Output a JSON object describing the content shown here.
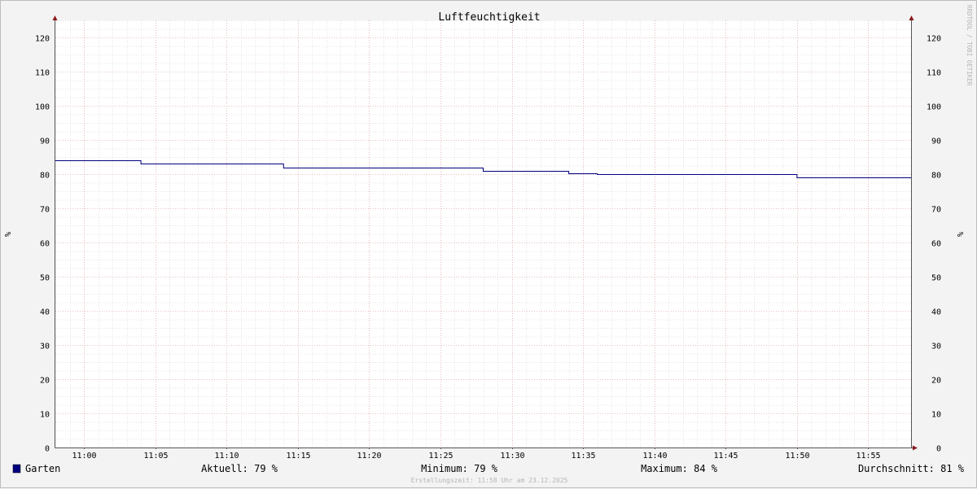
{
  "chart_data": {
    "type": "line",
    "title": "Luftfeuchtigkeit",
    "ylabel": "%",
    "ylabel_right": "%",
    "ylim": [
      0,
      125
    ],
    "yticks": [
      0,
      10,
      20,
      30,
      40,
      50,
      60,
      70,
      80,
      90,
      100,
      110,
      120
    ],
    "xlim": [
      "10:58",
      "11:58"
    ],
    "xticks": [
      "11:00",
      "11:05",
      "11:10",
      "11:15",
      "11:20",
      "11:25",
      "11:30",
      "11:35",
      "11:40",
      "11:45",
      "11:50",
      "11:55"
    ],
    "grid": true,
    "series": [
      {
        "name": "Garten",
        "color": "#000080",
        "points": [
          [
            "10:58",
            84
          ],
          [
            "11:04",
            84
          ],
          [
            "11:04",
            83
          ],
          [
            "11:14",
            83
          ],
          [
            "11:14",
            82
          ],
          [
            "11:28",
            82
          ],
          [
            "11:28",
            81
          ],
          [
            "11:34",
            81
          ],
          [
            "11:34",
            80.2
          ],
          [
            "11:36",
            80.2
          ],
          [
            "11:36",
            80
          ],
          [
            "11:50",
            80
          ],
          [
            "11:50",
            79
          ],
          [
            "11:58",
            79
          ]
        ]
      }
    ],
    "legend": {
      "swatch_color": "#000080",
      "name": "Garten",
      "stats": [
        {
          "label": "Aktuell:",
          "value": "79 %"
        },
        {
          "label": "Minimum:",
          "value": "79 %"
        },
        {
          "label": "Maximum:",
          "value": "84 %"
        },
        {
          "label": "Durchschnitt:",
          "value": "81 %"
        }
      ]
    },
    "watermark": "RRDTOOL / TOBI OETIKER",
    "footer": "Erstellungszeit: 11:58 Uhr am 23.12.2025",
    "colors": {
      "major_grid": "#e8a0a0",
      "minor_grid": "#c8c8c8",
      "axis": "#555555",
      "arrow": "#8b1a1a",
      "plot_bg": "#ffffff"
    }
  }
}
